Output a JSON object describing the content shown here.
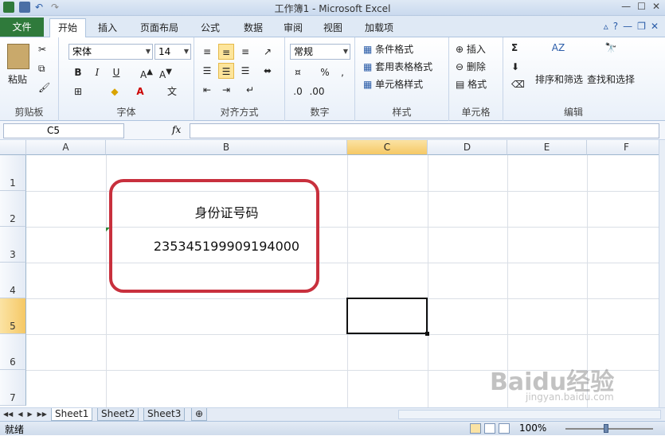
{
  "window": {
    "title": "工作簿1 - Microsoft Excel"
  },
  "tabs": {
    "file": "文件",
    "items": [
      "开始",
      "插入",
      "页面布局",
      "公式",
      "数据",
      "审阅",
      "视图",
      "加载项"
    ],
    "active": "开始"
  },
  "ribbon": {
    "clipboard": {
      "label": "剪贴板",
      "paste": "粘贴"
    },
    "font": {
      "label": "字体",
      "name": "宋体",
      "size": "14",
      "bold": "B",
      "italic": "I",
      "underline": "U"
    },
    "alignment": {
      "label": "对齐方式"
    },
    "number": {
      "label": "数字",
      "format": "常规",
      "percent": "%",
      "comma": ","
    },
    "styles": {
      "label": "样式",
      "conditional": "条件格式",
      "table": "套用表格格式",
      "cell": "单元格样式"
    },
    "cells": {
      "label": "单元格",
      "insert": "插入",
      "delete": "删除",
      "format": "格式"
    },
    "editing": {
      "label": "编辑",
      "sum": "Σ",
      "sort": "排序和筛选",
      "find": "查找和选择"
    }
  },
  "formula_bar": {
    "name_box": "C5",
    "fx": "fx",
    "content": ""
  },
  "columns": [
    "A",
    "B",
    "C",
    "D",
    "E",
    "F"
  ],
  "rows": [
    "1",
    "2",
    "3",
    "4",
    "5",
    "6",
    "7"
  ],
  "selected_cell": {
    "column": "C",
    "row": "5"
  },
  "cells": {
    "B2": "身份证号码",
    "B3": "235345199909194000"
  },
  "sheets": [
    "Sheet1",
    "Sheet2",
    "Sheet3"
  ],
  "active_sheet": "Sheet1",
  "status": {
    "ready": "就绪",
    "zoom": "100%"
  },
  "watermark": {
    "brand": "Baidu经验",
    "url": "jingyan.baidu.com"
  },
  "colors": {
    "accent": "#2f7a3b",
    "highlight": "#c8303d",
    "selection": "#f5c865"
  }
}
